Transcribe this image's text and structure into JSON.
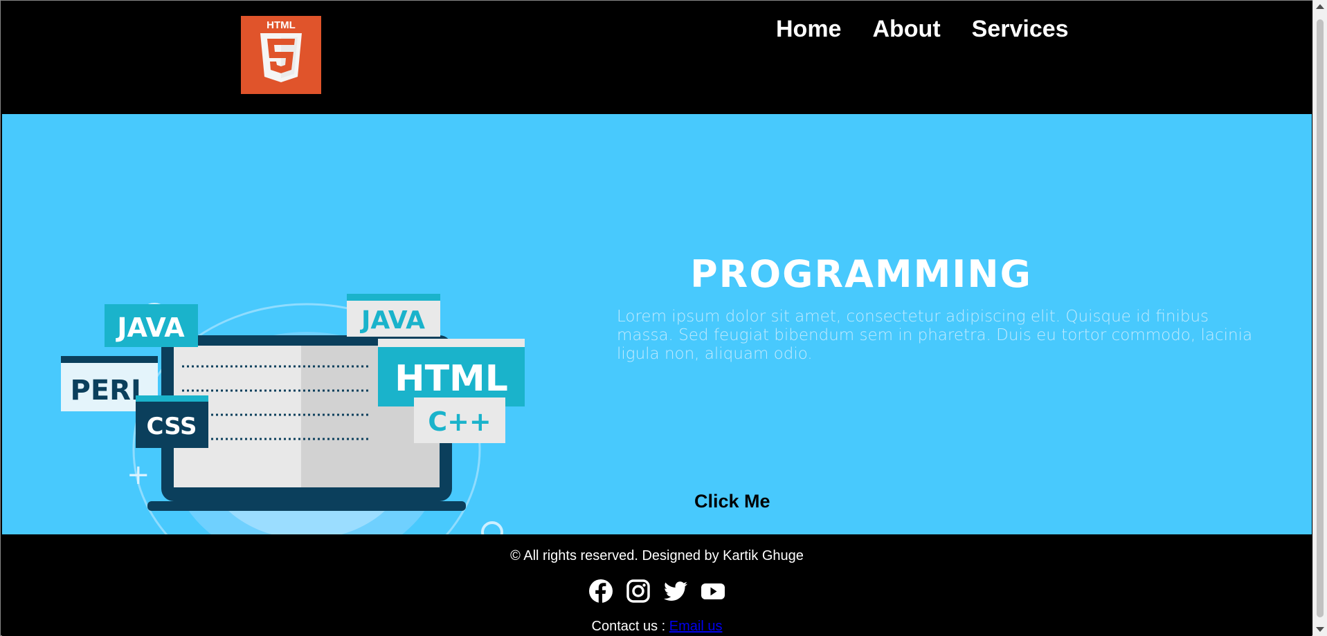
{
  "header": {
    "logo_alt": "HTML 5 logo",
    "logo_text": "HTML",
    "logo_number": "5",
    "nav": [
      {
        "label": "Home"
      },
      {
        "label": "About"
      },
      {
        "label": "Services"
      }
    ]
  },
  "hero": {
    "illustration_labels": [
      "JAVA",
      "JAVA",
      "PERL",
      "HTML",
      "CSS",
      "C++"
    ],
    "title": "PROGRAMMING",
    "text": "Lorem ipsum dolor sit amet, consectetur adipiscing elit. Quisque id finibus massa. Sed feugiat bibendum sem in pharetra. Duis eu tortor commodo, lacinia ligula non, aliquam odio.",
    "button_label": "Click Me"
  },
  "footer": {
    "copyright": "© All rights reserved. Designed by Kartik Ghuge",
    "social_icons": [
      "facebook-icon",
      "instagram-icon",
      "twitter-icon",
      "youtube-icon"
    ],
    "contact_prefix": "Contact us : ",
    "contact_link": "Email us"
  },
  "colors": {
    "hero_background": "#48c9fd",
    "header_background": "#000000",
    "footer_background": "#000000",
    "logo_orange": "#e44d26"
  }
}
